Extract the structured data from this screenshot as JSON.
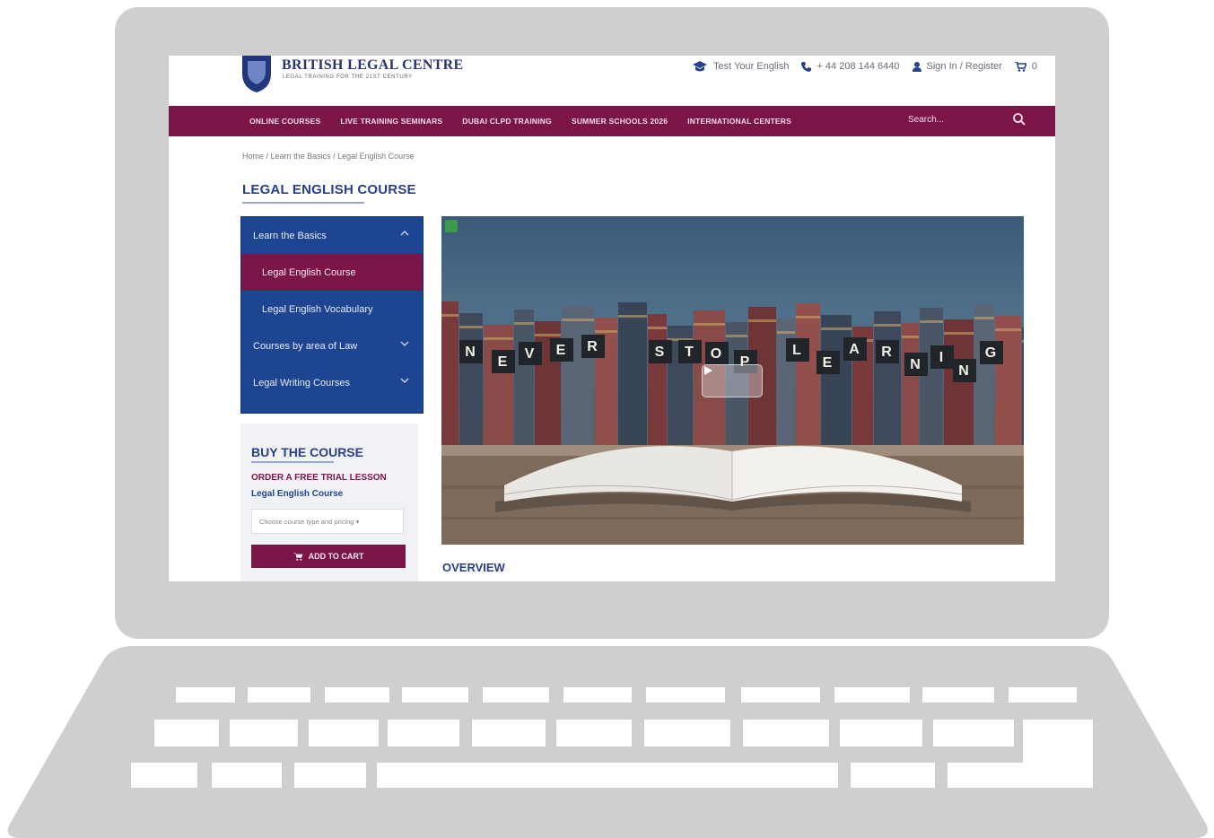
{
  "site": {
    "logo_title": "BRITISH LEGAL CENTRE",
    "logo_tagline": "LEGAL TRAINING FOR THE 21ST CENTURY",
    "top_links": {
      "test_english": "Test Your English",
      "phone": "+ 44 208 144 6440",
      "account": "Sign In / Register",
      "cart_count": "0"
    },
    "nav": [
      "ONLINE COURSES",
      "LIVE TRAINING SEMINARS",
      "DUBAI CLPD TRAINING",
      "SUMMER SCHOOLS 2026",
      "INTERNATIONAL CENTERS"
    ],
    "search_placeholder": "Search...",
    "breadcrumb": [
      "Home",
      "Learn the Basics",
      "Legal English Course"
    ],
    "page_title": "LEGAL ENGLISH COURSE",
    "sidebar": [
      {
        "label": "Learn the Basics",
        "chevron": "up"
      },
      {
        "label": "Legal English Course",
        "active": true
      },
      {
        "label": "Legal English Vocabulary"
      },
      {
        "label": "Courses by area of Law",
        "chevron": "down"
      },
      {
        "label": "Legal Writing Courses",
        "chevron": "down"
      }
    ],
    "buy": {
      "title": "BUY THE COURSE",
      "trial": "ORDER A FREE TRIAL LESSON",
      "course": "Legal English Course",
      "select_placeholder": "Choose course type and pricing ▾",
      "button": "ADD TO CART"
    },
    "hero": {
      "book_letters": [
        "N",
        "E",
        "V",
        "E",
        "R",
        "S",
        "T",
        "O",
        "P",
        "L",
        "E",
        "A",
        "R",
        "N",
        "I",
        "N",
        "G"
      ]
    },
    "section_title": "OVERVIEW"
  },
  "colors": {
    "brand_maroon": "#7b1548",
    "brand_blue": "#1e4591",
    "laptop_gray": "#cfcfcf"
  },
  "icons": [
    "graduation-cap-icon",
    "phone-icon",
    "user-icon",
    "cart-icon",
    "search-icon",
    "chevron-up-icon",
    "chevron-down-icon",
    "play-icon"
  ]
}
